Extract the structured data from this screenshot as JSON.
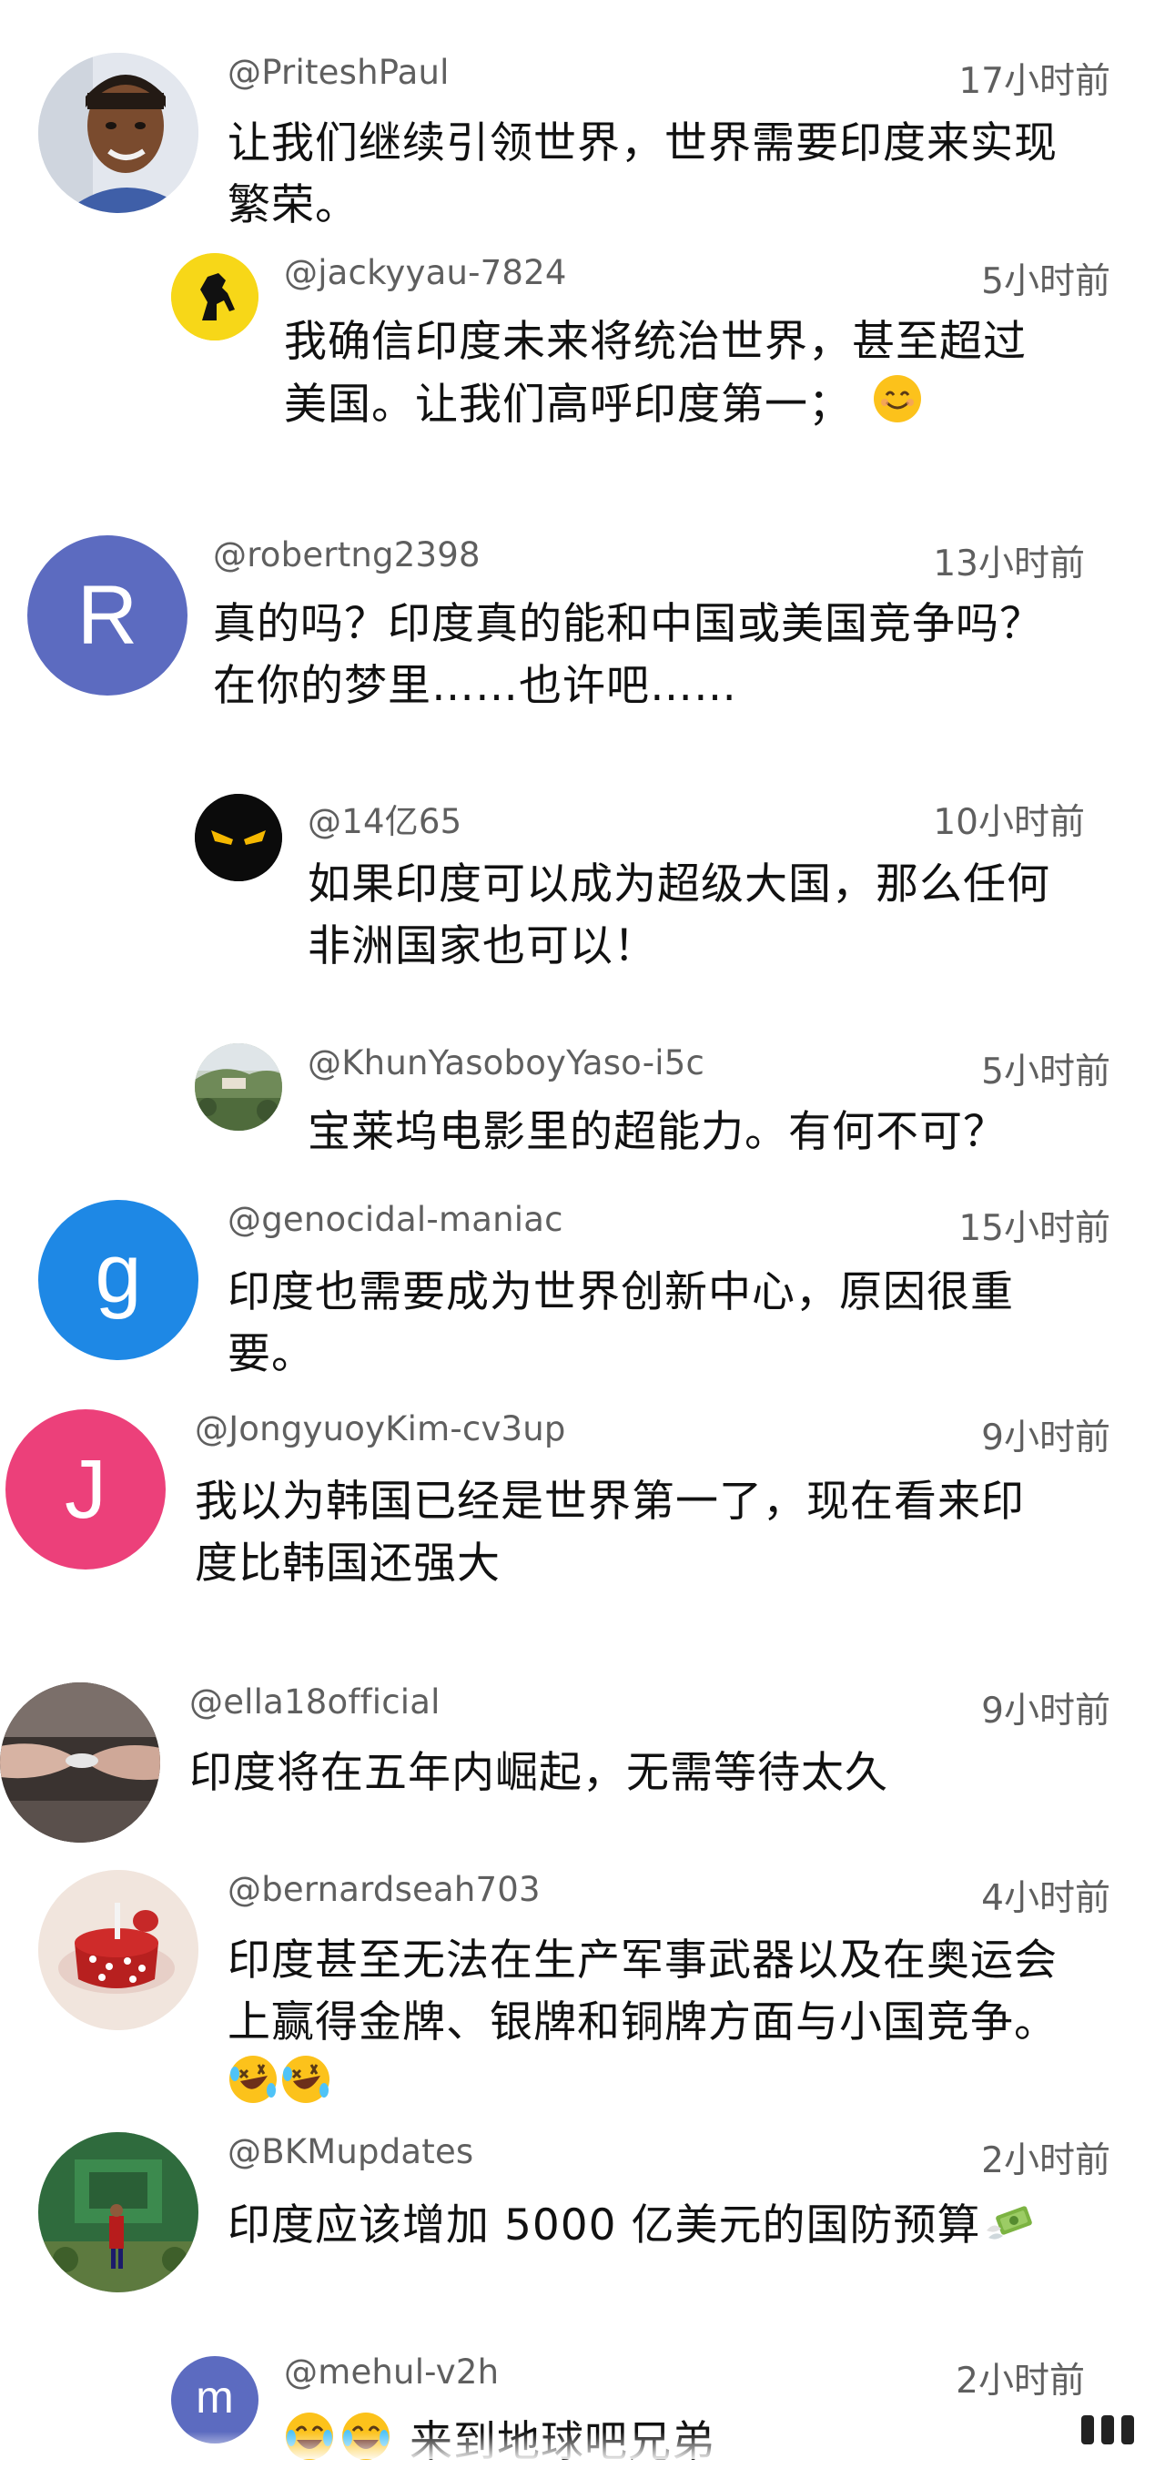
{
  "comments": [
    {
      "author": "@PriteshPaul",
      "time": "17小时前",
      "line1": "让我们继续引领世界，世界需要印度来实现",
      "line2": "繁荣。",
      "avatar_icon": "man-photo-avatar"
    },
    {
      "author": "@jackyyau-7824",
      "time": "5小时前",
      "line1": "我确信印度未来将统治世界，甚至超过",
      "line2": "美国。让我们高呼印度第一；",
      "avatar_icon": "prancing-horse-logo-avatar"
    },
    {
      "author": "@robertng2398",
      "time": "13小时前",
      "line1": "真的吗？印度真的能和中国或美国竞争吗？",
      "line2": "在你的梦里……也许吧……",
      "avatar_letter": "R",
      "avatar_color": "#5c6bc0"
    },
    {
      "author": "@14亿65",
      "time": "10小时前",
      "line1": "如果印度可以成为超级大国，那么任何",
      "line2": "非洲国家也可以！",
      "avatar_icon": "angry-eyes-avatar"
    },
    {
      "author": "@KhunYasoboyYaso-i5c",
      "time": "5小时前",
      "line1": "宝莱坞电影里的超能力。有何不可？",
      "avatar_icon": "landscape-photo-avatar"
    },
    {
      "author": "@genocidal-maniac",
      "time": "15小时前",
      "line1": "印度也需要成为世界创新中心，原因很重",
      "line2": "要。",
      "avatar_letter": "g",
      "avatar_color": "#1e88e5"
    },
    {
      "author": "@JongyuoyKim-cv3up",
      "time": "9小时前",
      "line1": "我以为韩国已经是世界第一了，现在看来印",
      "line2": "度比韩国还强大",
      "avatar_letter": "J",
      "avatar_color": "#ec407a"
    },
    {
      "author": "@ella18official",
      "time": "9小时前",
      "line1": "印度将在五年内崛起，无需等待太久",
      "avatar_icon": "hands-photo-avatar"
    },
    {
      "author": "@bernardseah703",
      "time": "4小时前",
      "line1": "印度甚至无法在生产军事武器以及在奥运会",
      "line2": "上赢得金牌、银牌和铜牌方面与小国竞争。",
      "avatar_icon": "cake-photo-avatar"
    },
    {
      "author": "@BKMupdates",
      "time": "2小时前",
      "line1": "印度应该增加 5000 亿美元的国防预算",
      "avatar_icon": "statue-photo-avatar"
    },
    {
      "author": "@mehul-v2h",
      "time": "2小时前",
      "line1": "来到地球吧兄弟",
      "avatar_letter": "m",
      "avatar_color": "#5c6bc0"
    }
  ]
}
